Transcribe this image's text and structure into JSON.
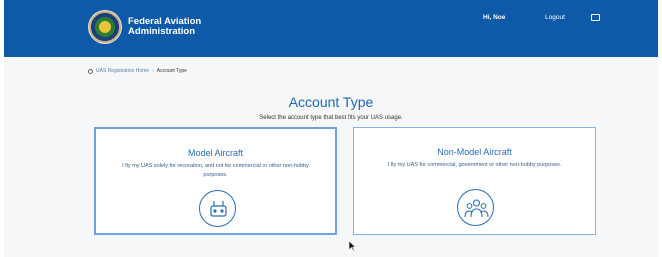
{
  "header": {
    "brand_line1": "Federal Aviation",
    "brand_line2": "Administration",
    "user_greeting": "Hi, Noe",
    "logout_label": "Logout",
    "bg_color": "#0f5aa8"
  },
  "breadcrumb": {
    "home_label": "UAS Registration Home",
    "separator": "›",
    "current": "Account Type"
  },
  "main": {
    "title": "Account Type",
    "subtitle": "Select the account type that best fits your UAS usage."
  },
  "cards": {
    "model": {
      "title": "Model Aircraft",
      "text": "I fly my UAS solely for recreation, and not for commercial or other non-hobby purposes.",
      "icon": "drone-controller-icon"
    },
    "non_model": {
      "title": "Non-Model Aircraft",
      "text": "I fly my UAS for commercial, government or other non-hobby purposes.",
      "icon": "people-group-icon"
    }
  },
  "colors": {
    "accent": "#1f67b1",
    "card_border": "#8bb1de"
  }
}
